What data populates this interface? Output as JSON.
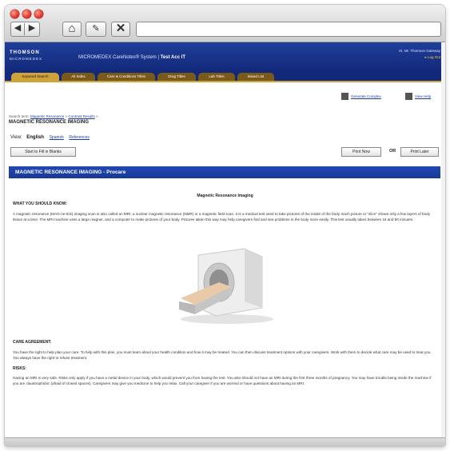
{
  "browser": {
    "traffic_lights": [
      "close",
      "minimize",
      "zoom"
    ],
    "back_label": "◀",
    "forward_label": "▶",
    "home_label": "⌂",
    "bookmark_label": "✎",
    "stop_label": "✕",
    "url": ""
  },
  "app": {
    "logo_top": "THOMSON",
    "logo_bottom": "MICROMEDEX",
    "product_prefix": "MICROMEDEX CareNotes® System",
    "product_account": "Test Acc IT",
    "user_line": "Hi, Mr. Thomson Gateway",
    "logout_label": "▸ Log Out",
    "tabs": [
      {
        "label": "Keyword Search",
        "active": true
      },
      {
        "label": "Alt Index",
        "active": false
      },
      {
        "label": "Care & Conditions Titles",
        "active": false
      },
      {
        "label": "Drug Titles",
        "active": false
      },
      {
        "label": "Lab Titles",
        "active": false
      },
      {
        "label": "Mixed List",
        "active": false
      }
    ],
    "top_links": [
      "Generate Complex",
      "View Help"
    ],
    "breadcrumb_prefix": "Search term:",
    "breadcrumb_items": [
      "Magnetic Resonance",
      "Contrast Results"
    ],
    "page_title": "MAGNETIC RESONANCE IMAGING",
    "view_label": "View:",
    "view_current": "English",
    "view_links": [
      "Spanish",
      "References"
    ],
    "fill_blanks_button": "Start to Fill in Blanks",
    "print_now_button": "Print Now",
    "or_label": "OR",
    "print_later_button": "Print Later"
  },
  "document": {
    "section_title": "MAGNETIC RESONANCE IMAGING - Procare",
    "doc_title": "Magnetic Resonance Imaging",
    "what_heading": "WHAT YOU SHOULD KNOW:",
    "what_text": "A magnetic resonance (MAG-ne-tick) imaging scan is also called an MRI, a nuclear magnetic resonance (NMR) or a magnetic field scan. It is a medical test used to take pictures of the inside of the body. Each picture or \"slice\" shows only a few layers of body tissue at a time. The MRI machine uses a large magnet, and a computer to make pictures of your body. Pictures taken this way may help caregivers find and see problems in the body more easily. This test usually takes between 15 and 90 minutes.",
    "care_heading": "CARE AGREEMENT:",
    "care_text": "You have the right to help plan your care. To help with this plan, you must learn about your health condition and how it may be treated. You can then discuss treatment options with your caregivers. Work with them to decide what care may be used to treat you. You always have the right to refuse treatment.",
    "risks_heading": "RISKS:",
    "risks_text": "Having an MRI is very safe. Risks only apply if you have a metal device in your body, which would prevent you from having the test. You also should not have an MRI during the first three months of pregnancy. You may have trouble being inside the machine if you are claustrophobic (afraid of closed spaces). Caregivers may give you medicine to help you relax. Call your caregiver if you are worried or have questions about having an MRI."
  }
}
